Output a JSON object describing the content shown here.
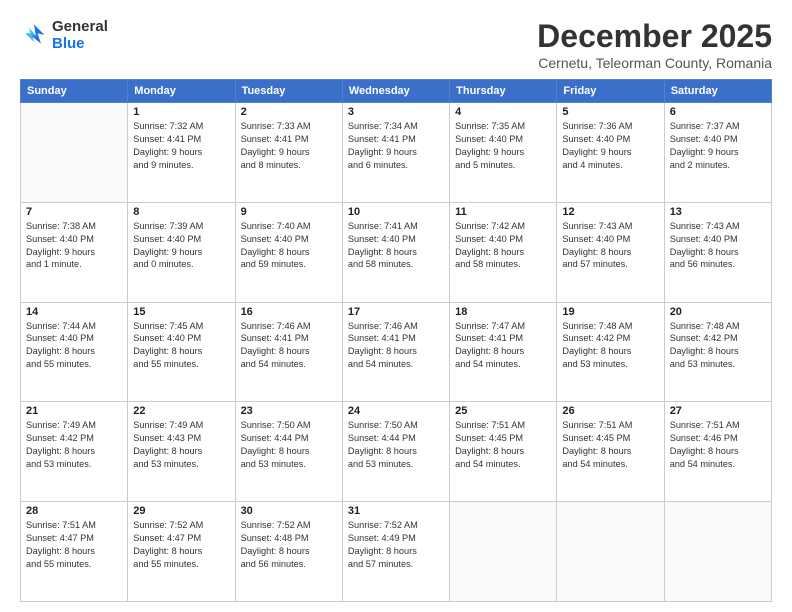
{
  "logo": {
    "line1": "General",
    "line2": "Blue"
  },
  "title": "December 2025",
  "subtitle": "Cernetu, Teleorman County, Romania",
  "header_days": [
    "Sunday",
    "Monday",
    "Tuesday",
    "Wednesday",
    "Thursday",
    "Friday",
    "Saturday"
  ],
  "weeks": [
    [
      {
        "day": "",
        "info": ""
      },
      {
        "day": "1",
        "info": "Sunrise: 7:32 AM\nSunset: 4:41 PM\nDaylight: 9 hours\nand 9 minutes."
      },
      {
        "day": "2",
        "info": "Sunrise: 7:33 AM\nSunset: 4:41 PM\nDaylight: 9 hours\nand 8 minutes."
      },
      {
        "day": "3",
        "info": "Sunrise: 7:34 AM\nSunset: 4:41 PM\nDaylight: 9 hours\nand 6 minutes."
      },
      {
        "day": "4",
        "info": "Sunrise: 7:35 AM\nSunset: 4:40 PM\nDaylight: 9 hours\nand 5 minutes."
      },
      {
        "day": "5",
        "info": "Sunrise: 7:36 AM\nSunset: 4:40 PM\nDaylight: 9 hours\nand 4 minutes."
      },
      {
        "day": "6",
        "info": "Sunrise: 7:37 AM\nSunset: 4:40 PM\nDaylight: 9 hours\nand 2 minutes."
      }
    ],
    [
      {
        "day": "7",
        "info": "Sunrise: 7:38 AM\nSunset: 4:40 PM\nDaylight: 9 hours\nand 1 minute."
      },
      {
        "day": "8",
        "info": "Sunrise: 7:39 AM\nSunset: 4:40 PM\nDaylight: 9 hours\nand 0 minutes."
      },
      {
        "day": "9",
        "info": "Sunrise: 7:40 AM\nSunset: 4:40 PM\nDaylight: 8 hours\nand 59 minutes."
      },
      {
        "day": "10",
        "info": "Sunrise: 7:41 AM\nSunset: 4:40 PM\nDaylight: 8 hours\nand 58 minutes."
      },
      {
        "day": "11",
        "info": "Sunrise: 7:42 AM\nSunset: 4:40 PM\nDaylight: 8 hours\nand 58 minutes."
      },
      {
        "day": "12",
        "info": "Sunrise: 7:43 AM\nSunset: 4:40 PM\nDaylight: 8 hours\nand 57 minutes."
      },
      {
        "day": "13",
        "info": "Sunrise: 7:43 AM\nSunset: 4:40 PM\nDaylight: 8 hours\nand 56 minutes."
      }
    ],
    [
      {
        "day": "14",
        "info": "Sunrise: 7:44 AM\nSunset: 4:40 PM\nDaylight: 8 hours\nand 55 minutes."
      },
      {
        "day": "15",
        "info": "Sunrise: 7:45 AM\nSunset: 4:40 PM\nDaylight: 8 hours\nand 55 minutes."
      },
      {
        "day": "16",
        "info": "Sunrise: 7:46 AM\nSunset: 4:41 PM\nDaylight: 8 hours\nand 54 minutes."
      },
      {
        "day": "17",
        "info": "Sunrise: 7:46 AM\nSunset: 4:41 PM\nDaylight: 8 hours\nand 54 minutes."
      },
      {
        "day": "18",
        "info": "Sunrise: 7:47 AM\nSunset: 4:41 PM\nDaylight: 8 hours\nand 54 minutes."
      },
      {
        "day": "19",
        "info": "Sunrise: 7:48 AM\nSunset: 4:42 PM\nDaylight: 8 hours\nand 53 minutes."
      },
      {
        "day": "20",
        "info": "Sunrise: 7:48 AM\nSunset: 4:42 PM\nDaylight: 8 hours\nand 53 minutes."
      }
    ],
    [
      {
        "day": "21",
        "info": "Sunrise: 7:49 AM\nSunset: 4:42 PM\nDaylight: 8 hours\nand 53 minutes."
      },
      {
        "day": "22",
        "info": "Sunrise: 7:49 AM\nSunset: 4:43 PM\nDaylight: 8 hours\nand 53 minutes."
      },
      {
        "day": "23",
        "info": "Sunrise: 7:50 AM\nSunset: 4:44 PM\nDaylight: 8 hours\nand 53 minutes."
      },
      {
        "day": "24",
        "info": "Sunrise: 7:50 AM\nSunset: 4:44 PM\nDaylight: 8 hours\nand 53 minutes."
      },
      {
        "day": "25",
        "info": "Sunrise: 7:51 AM\nSunset: 4:45 PM\nDaylight: 8 hours\nand 54 minutes."
      },
      {
        "day": "26",
        "info": "Sunrise: 7:51 AM\nSunset: 4:45 PM\nDaylight: 8 hours\nand 54 minutes."
      },
      {
        "day": "27",
        "info": "Sunrise: 7:51 AM\nSunset: 4:46 PM\nDaylight: 8 hours\nand 54 minutes."
      }
    ],
    [
      {
        "day": "28",
        "info": "Sunrise: 7:51 AM\nSunset: 4:47 PM\nDaylight: 8 hours\nand 55 minutes."
      },
      {
        "day": "29",
        "info": "Sunrise: 7:52 AM\nSunset: 4:47 PM\nDaylight: 8 hours\nand 55 minutes."
      },
      {
        "day": "30",
        "info": "Sunrise: 7:52 AM\nSunset: 4:48 PM\nDaylight: 8 hours\nand 56 minutes."
      },
      {
        "day": "31",
        "info": "Sunrise: 7:52 AM\nSunset: 4:49 PM\nDaylight: 8 hours\nand 57 minutes."
      },
      {
        "day": "",
        "info": ""
      },
      {
        "day": "",
        "info": ""
      },
      {
        "day": "",
        "info": ""
      }
    ]
  ]
}
